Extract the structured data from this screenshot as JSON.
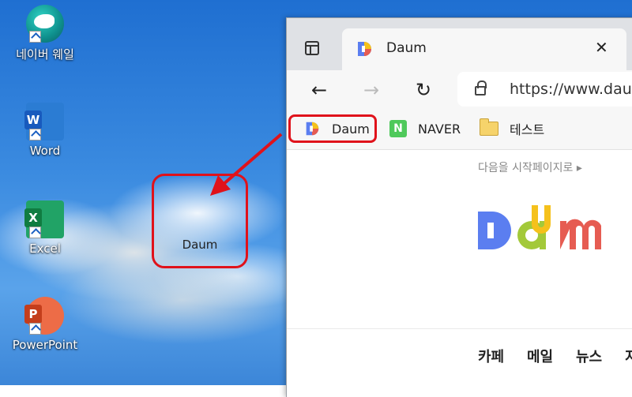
{
  "desktop": {
    "icons": [
      {
        "label": "네이버 웨일",
        "icon": "whale-browser-icon"
      },
      {
        "label": "Word",
        "icon": "word-icon"
      },
      {
        "label": "Excel",
        "icon": "excel-icon"
      },
      {
        "label": "PowerPoint",
        "icon": "powerpoint-icon"
      }
    ],
    "dragged_shortcut": {
      "label": "Daum"
    }
  },
  "browser": {
    "tab": {
      "title": "Daum",
      "close": "✕"
    },
    "address": {
      "url": "https://www.daum"
    },
    "nav": {
      "back": "←",
      "forward": "→",
      "refresh": "↻"
    },
    "favorites": [
      {
        "label": "Daum",
        "icon": "daum-favicon"
      },
      {
        "label": "NAVER",
        "icon": "naver-favicon",
        "icon_letter": "N"
      },
      {
        "label": "테스트",
        "icon": "folder-icon"
      }
    ],
    "page": {
      "start_page_link": "다음을 시작페이지로 ▸",
      "menu": [
        "카페",
        "메일",
        "뉴스",
        "지"
      ]
    }
  },
  "colors": {
    "highlight": "#e0121b",
    "daum_blue": "#5b7ef0",
    "daum_yellow": "#f5c11c",
    "daum_green": "#a3c93a",
    "daum_red": "#e65c52"
  }
}
